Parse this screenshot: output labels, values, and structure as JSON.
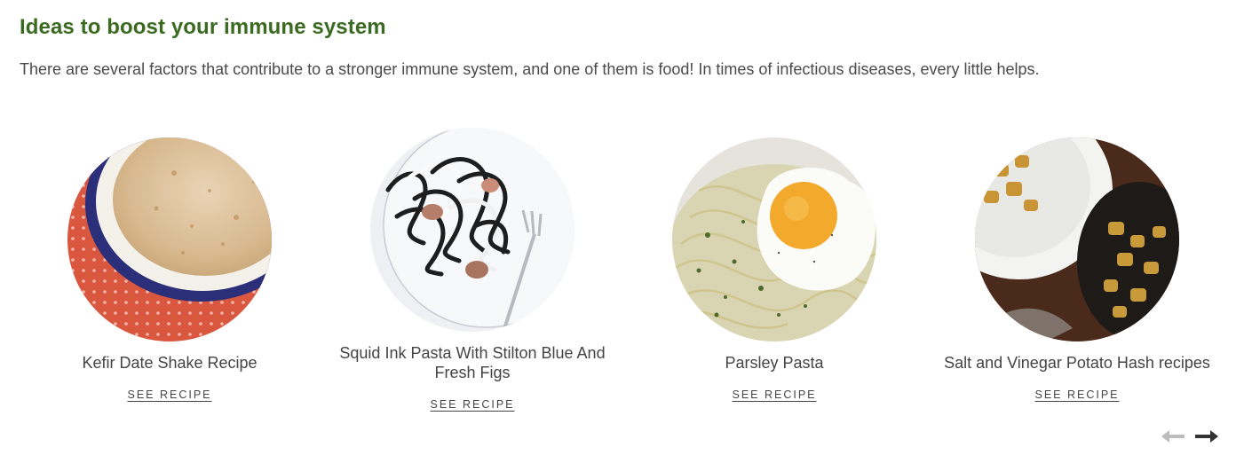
{
  "section": {
    "title": "Ideas to boost your immune system",
    "description": "There are several factors that contribute to a stronger immune system, and one of them is food! In times of infectious diseases, every little helps."
  },
  "recipes": [
    {
      "name": "Kefir Date Shake Recipe",
      "link_label": "SEE RECIPE",
      "image": "kefir-date-shake-photo"
    },
    {
      "name": "Squid Ink Pasta With Stilton Blue And Fresh Figs",
      "link_label": "SEE RECIPE",
      "image": "squid-ink-pasta-photo"
    },
    {
      "name": "Parsley Pasta",
      "link_label": "SEE RECIPE",
      "image": "parsley-pasta-photo"
    },
    {
      "name": "Salt and Vinegar Potato Hash recipes",
      "link_label": "SEE RECIPE",
      "image": "potato-hash-photo"
    }
  ],
  "carousel": {
    "prev_icon": "arrow-left-icon",
    "next_icon": "arrow-right-icon",
    "prev_enabled": false,
    "next_enabled": true
  },
  "colors": {
    "title": "#3b6a21",
    "text": "#4a4a4a",
    "arrow_disabled": "#bdbdbd",
    "arrow_enabled": "#333333"
  }
}
